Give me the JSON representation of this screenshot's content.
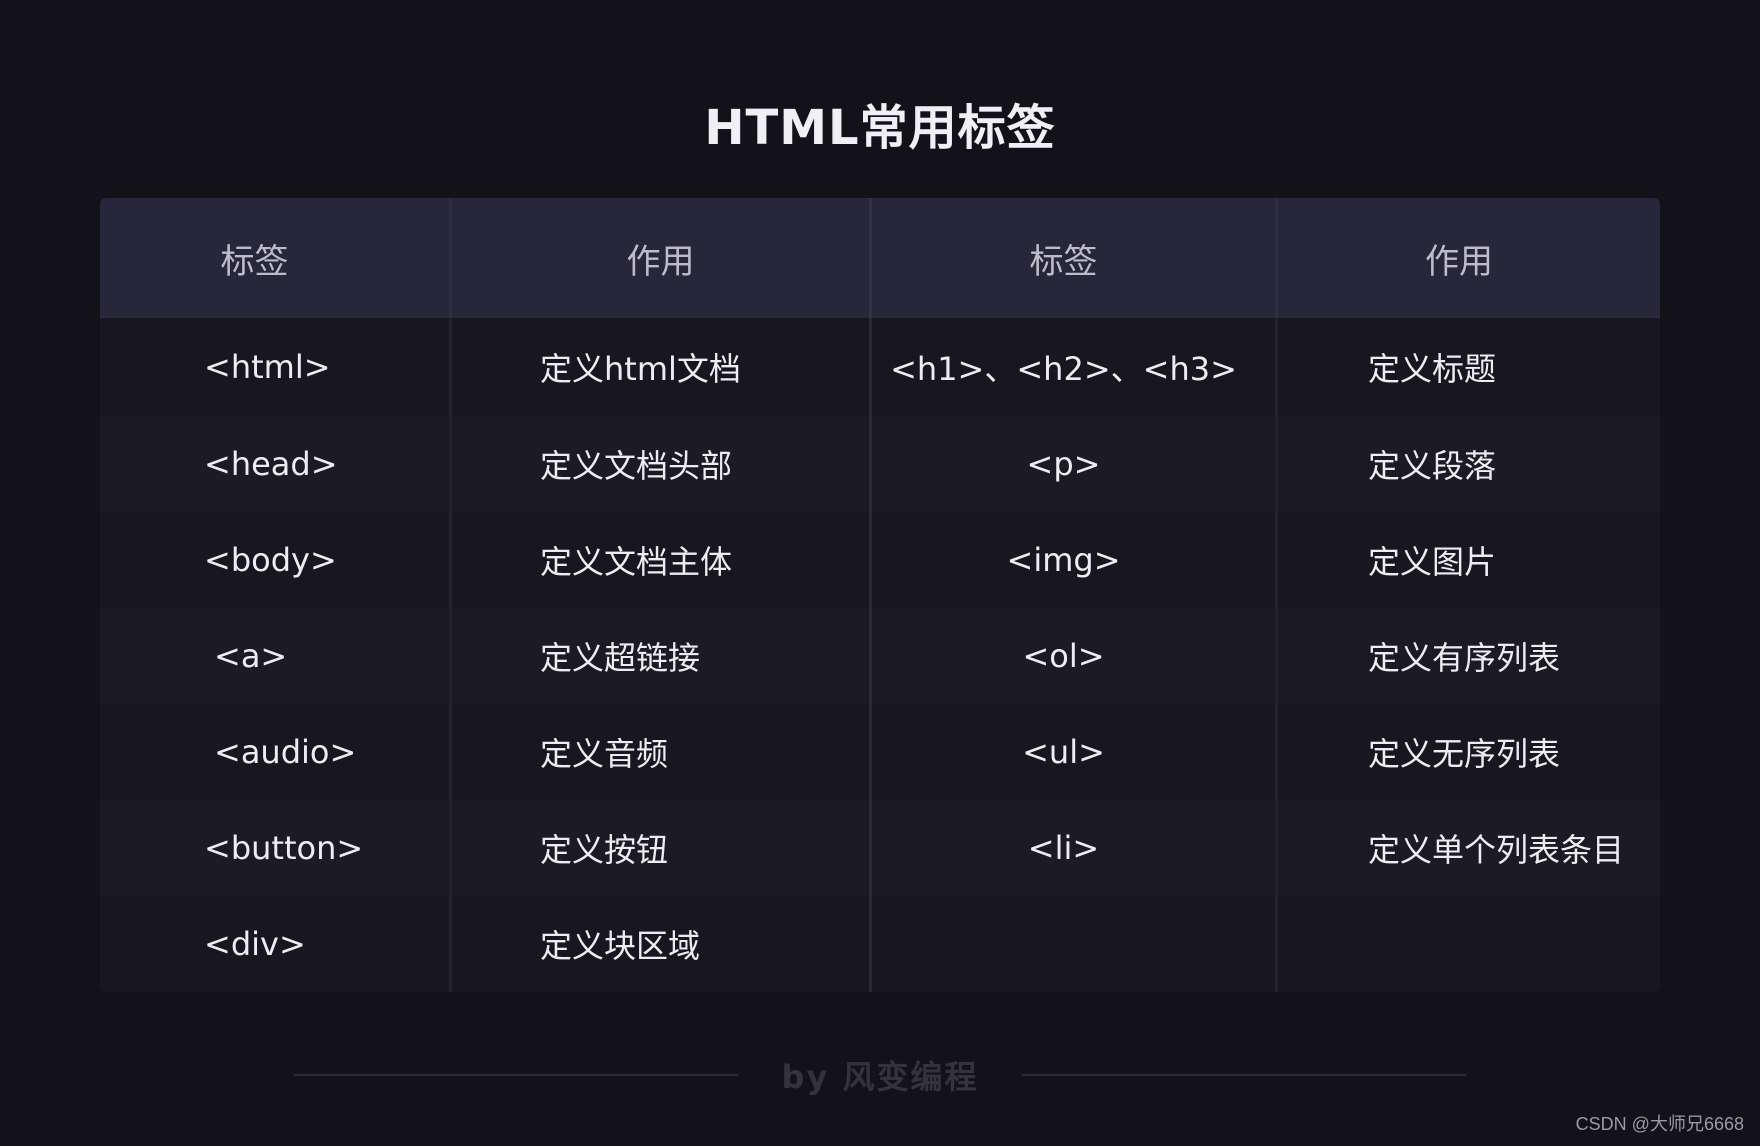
{
  "title": "HTML常用标签",
  "header": {
    "col1": "标签",
    "col2": "作用",
    "col3": "标签",
    "col4": "作用"
  },
  "rows": [
    {
      "tag1": "<html>",
      "desc1": "定义html文档",
      "tag2": "<h1>、<h2>、<h3>",
      "desc2": "定义标题"
    },
    {
      "tag1": "<head>",
      "desc1": "定义文档头部",
      "tag2": "<p>",
      "desc2": "定义段落"
    },
    {
      "tag1": "<body>",
      "desc1": "定义文档主体",
      "tag2": "<img>",
      "desc2": "定义图片"
    },
    {
      "tag1": "<a>",
      "desc1": "定义超链接",
      "tag2": "<ol>",
      "desc2": "定义有序列表"
    },
    {
      "tag1": "<audio>",
      "desc1": "定义音频",
      "tag2": "<ul>",
      "desc2": "定义无序列表"
    },
    {
      "tag1": "<button>",
      "desc1": "定义按钮",
      "tag2": "<li>",
      "desc2": "定义单个列表条目"
    },
    {
      "tag1": "<div>",
      "desc1": "定义块区域",
      "tag2": "",
      "desc2": ""
    }
  ],
  "footer": {
    "text": "by 风变编程"
  },
  "watermark": "CSDN @大师兄6668"
}
